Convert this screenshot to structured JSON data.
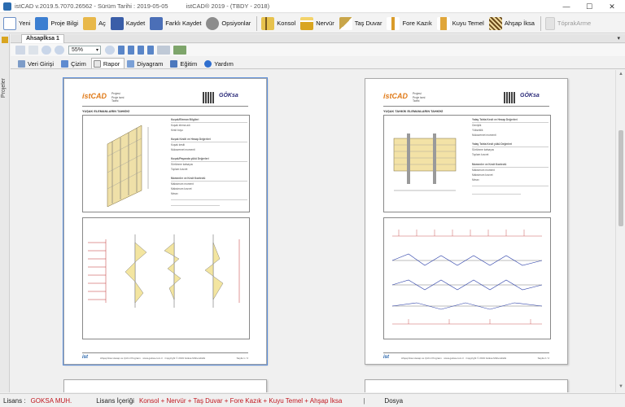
{
  "titlebar": {
    "app_version": "istCAD v.2019.5.7070.26562 -  Sürüm Tarihi : 2019-05-05",
    "product": "istCAD® 2019 - (TBDY - 2018)"
  },
  "toolbar": {
    "new": "Yeni",
    "project_info": "Proje Bilgi",
    "open": "Aç",
    "save": "Kaydet",
    "save_as": "Farklı Kaydet",
    "options": "Opsiyonlar",
    "konsol": "Konsol",
    "nervur": "Nervür",
    "tas_duvar": "Taş Duvar",
    "fore_kazik": "Fore Kazık",
    "kuyu_temel": "Kuyu Temel",
    "ahsap_iksa": "Ahşap İksa",
    "toprak_arme": "TóprakArme"
  },
  "left_strip": {
    "label": "Projeler"
  },
  "document_tab": {
    "label": "Ahsapİksa 1",
    "menu": "▾"
  },
  "secondary_toolbar": {
    "zoom": "55%"
  },
  "view_tabs": [
    "Veri Girişi",
    "Çizim",
    "Rapor",
    "Diyagram",
    "Eğitim",
    "Yardım"
  ],
  "active_view_tab": "Rapor",
  "pages": [
    {
      "section_title": "YUŞAK ELEMANLARIN TAHKİKİ",
      "logo": "ist",
      "logo_accent": "CAD",
      "brand": "GÖKsa",
      "meta": [
        "Projesi",
        "Proje ismi",
        "Tarihi"
      ],
      "table_rows": [
        "Kuşak/Eleman Bilgileri",
        "Kuşak elema adı",
        "Kesit boyu",
        "Kuşak Kesiti ve Hesap Değerleri",
        "Kuşak kesiti",
        "Mukavemet momenti",
        "Kuşak/Payanda yükü Değerleri",
        "Sürtünme katsayısı",
        "Toplam kuvvet",
        "Momenler ve Kesit Kontrolü",
        "Maksimum moment",
        "Maksimum kuvvet",
        "Mmax"
      ],
      "footer_text": "Ahşap İksa Hesap ve Çizim Programı · www.goksa.com.tr · Copyright © 2019 Göksa Mühendislik",
      "page_label": "Sayfa 1 / 2"
    },
    {
      "section_title": "YUŞAK TAHKİK ELEMANLARIN TAHKİKİ",
      "logo": "ist",
      "logo_accent": "CAD",
      "brand": "GÖKsa",
      "meta": [
        "Projesi",
        "Proje ismi",
        "Tarihi"
      ],
      "table_rows": [
        "Yatay Tahta Kesit ve Hesap Değerleri",
        "Genişlik",
        "Yükseklik",
        "Mukavemet momenti",
        "Yatay Tahta Kesit yükü Değerleri",
        "Sürtünme katsayısı",
        "Toplam kuvvet",
        "Momenler ve Kesit Kontrolü",
        "Maksimum moment",
        "Maksimum kuvvet",
        "Mmax"
      ],
      "footer_text": "Ahşap İksa Hesap ve Çizim Programı · www.goksa.com.tr · Copyright © 2019 Göksa Mühendislik",
      "page_label": "Sayfa 2 / 2"
    }
  ],
  "status": {
    "license_label": "Lisans :",
    "license_value": "GOKSA MUH.",
    "content_label": "Lisans İçeriği",
    "content_value": "Konsol + Nervür + Taş Duvar + Fore Kazık + Kuyu Temel + Ahşap İksa",
    "separator": "|",
    "file_label": "Dosya"
  },
  "colors": {
    "accent_red": "#c0161e",
    "brand_blue": "#1f5fa8",
    "brand_orange": "#e07b1a"
  }
}
